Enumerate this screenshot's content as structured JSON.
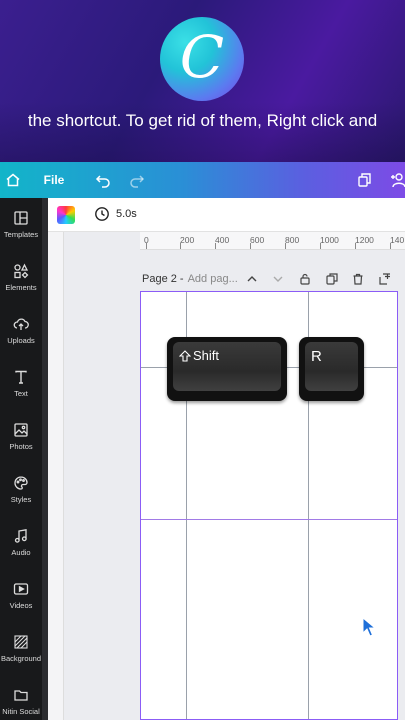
{
  "video": {
    "caption": "the shortcut. To get rid of them, Right click and",
    "logo_letter": "C"
  },
  "toolbar": {
    "home_icon": "home-icon",
    "file_label": "File",
    "undo_icon": "undo-icon",
    "redo_icon": "redo-icon",
    "resize_icon": "resize-icon",
    "share_icon": "add-person-icon"
  },
  "sidebar": {
    "items": [
      {
        "label": "Templates",
        "icon": "templates-icon"
      },
      {
        "label": "Elements",
        "icon": "elements-icon"
      },
      {
        "label": "Uploads",
        "icon": "upload-icon"
      },
      {
        "label": "Text",
        "icon": "text-icon"
      },
      {
        "label": "Photos",
        "icon": "photos-icon"
      },
      {
        "label": "Styles",
        "icon": "palette-icon"
      },
      {
        "label": "Audio",
        "icon": "music-icon"
      },
      {
        "label": "Videos",
        "icon": "video-icon"
      },
      {
        "label": "Background",
        "icon": "background-icon"
      },
      {
        "label": "Nitin Social",
        "icon": "folder-icon"
      }
    ]
  },
  "subbar": {
    "duration": "5.0s"
  },
  "ruler": {
    "ticks": [
      "0",
      "200",
      "400",
      "600",
      "800",
      "1000",
      "1200",
      "140"
    ]
  },
  "page": {
    "title": "Page 2 -",
    "add_title_placeholder": "Add pag..."
  },
  "keys": {
    "shift_label": "Shift",
    "r_label": "R"
  },
  "colors": {
    "accent": "#8b5cf6",
    "sidebar_bg": "#18191b",
    "toolbar_start": "#12b5c9",
    "toolbar_end": "#7d4be6"
  }
}
